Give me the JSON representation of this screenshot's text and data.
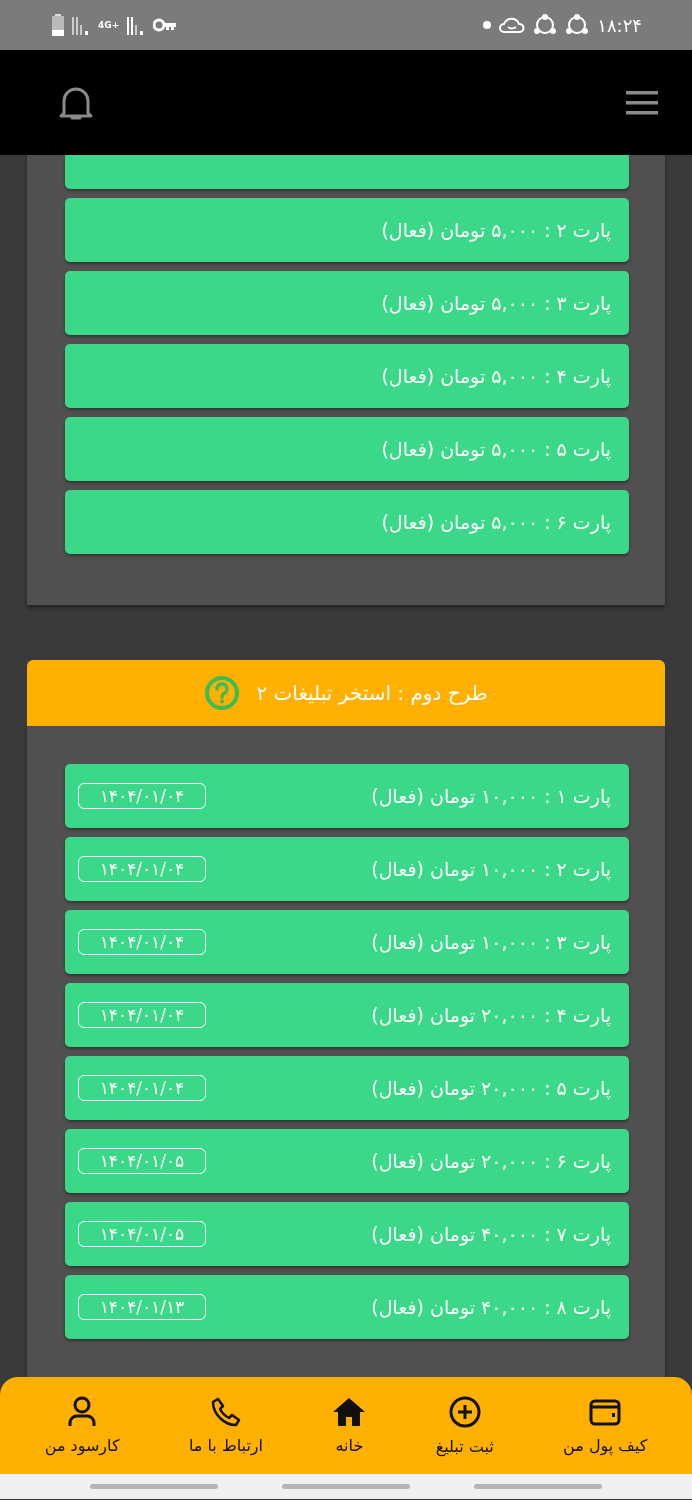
{
  "status_bar": {
    "time": "۱۸:۲۴",
    "network": "4G+"
  },
  "plans": [
    {
      "parts": [
        {
          "kind": "covered"
        },
        {
          "kind": "part",
          "text": "پارت ۲ : ۵,۰۰۰ تومان (فعال)"
        },
        {
          "kind": "part",
          "text": "پارت ۳ : ۵,۰۰۰ تومان (فعال)"
        },
        {
          "kind": "part",
          "text": "پارت ۴ : ۵,۰۰۰ تومان (فعال)"
        },
        {
          "kind": "part",
          "text": "پارت ۵ : ۵,۰۰۰ تومان (فعال)"
        },
        {
          "kind": "part",
          "text": "پارت ۶ : ۵,۰۰۰ تومان (فعال)"
        }
      ]
    },
    {
      "title": "طرح دوم : استخر تبلیغات ۲",
      "parts": [
        {
          "text": "پارت ۱ : ۱۰,۰۰۰ تومان (فعال)",
          "date": "۱۴۰۴/۰۱/۰۴"
        },
        {
          "text": "پارت ۲ : ۱۰,۰۰۰ تومان (فعال)",
          "date": "۱۴۰۴/۰۱/۰۴"
        },
        {
          "text": "پارت ۳ : ۱۰,۰۰۰ تومان (فعال)",
          "date": "۱۴۰۴/۰۱/۰۴"
        },
        {
          "text": "پارت ۴ : ۲۰,۰۰۰ تومان (فعال)",
          "date": "۱۴۰۴/۰۱/۰۴"
        },
        {
          "text": "پارت ۵ : ۲۰,۰۰۰ تومان (فعال)",
          "date": "۱۴۰۴/۰۱/۰۴"
        },
        {
          "text": "پارت ۶ : ۲۰,۰۰۰ تومان (فعال)",
          "date": "۱۴۰۴/۰۱/۰۵"
        },
        {
          "text": "پارت ۷ : ۴۰,۰۰۰ تومان (فعال)",
          "date": "۱۴۰۴/۰۱/۰۵"
        },
        {
          "text": "پارت ۸ : ۴۰,۰۰۰ تومان (فعال)",
          "date": "۱۴۰۴/۰۱/۱۳"
        }
      ]
    }
  ],
  "bottom_nav": [
    {
      "kind": "wallet",
      "label": "کیف پول من"
    },
    {
      "kind": "add",
      "label": "ثبت تبلیغ"
    },
    {
      "kind": "home",
      "label": "خانه"
    },
    {
      "kind": "phone",
      "label": "ارتباط با ما"
    },
    {
      "kind": "user",
      "label": "کارسود من"
    }
  ]
}
